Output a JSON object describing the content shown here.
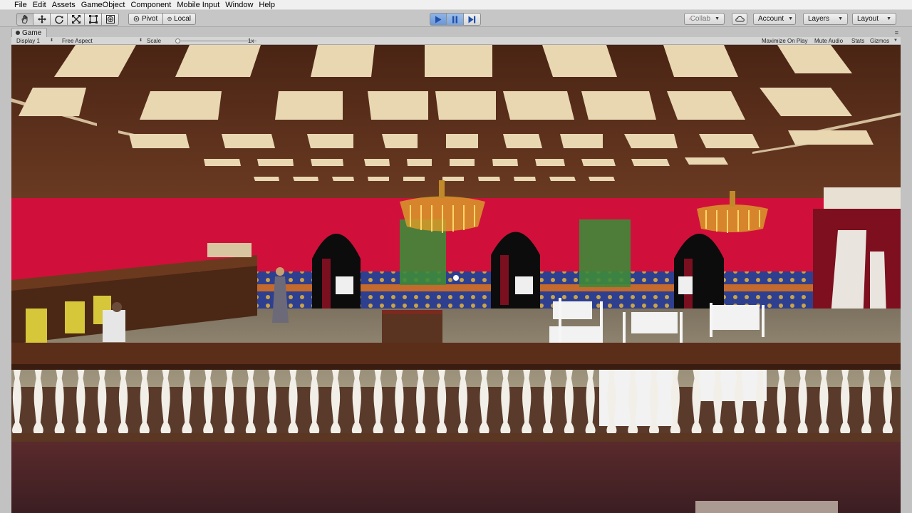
{
  "menu": [
    "File",
    "Edit",
    "Assets",
    "GameObject",
    "Component",
    "Mobile Input",
    "Window",
    "Help"
  ],
  "toolbar": {
    "tools": [
      "hand-tool",
      "move-tool",
      "rotate-tool",
      "scale-tool",
      "rect-tool",
      "transform-tool"
    ],
    "pivot_label": "Pivot",
    "local_label": "Local",
    "collab_label": "Collab",
    "account_label": "Account",
    "layers_label": "Layers",
    "layout_label": "Layout"
  },
  "game_tab": {
    "title": "Game"
  },
  "game_bar": {
    "display": "Display 1",
    "aspect": "Free Aspect",
    "scale_label": "Scale",
    "scale_value": "1x",
    "maximize_on_play": "Maximize On Play",
    "mute_audio": "Mute Audio",
    "stats": "Stats",
    "gizmos": "Gizmos"
  },
  "colors": {
    "wall": "#d0103a",
    "ceiling_beam": "#5b2e1a",
    "ceiling_panel": "#e9d7b2",
    "play_accent": "#5b8fd9",
    "railing": "#f2efe8"
  },
  "scene": {
    "description_icon": "restaurant-3d-scene"
  }
}
